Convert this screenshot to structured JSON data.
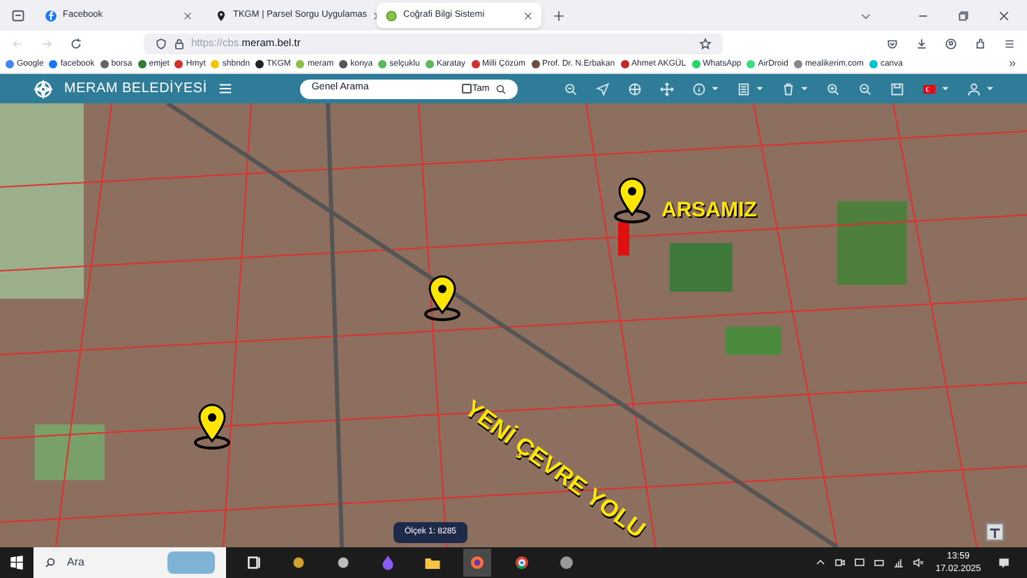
{
  "tabs": [
    {
      "label": "Facebook",
      "selected": false
    },
    {
      "label": "TKGM | Parsel Sorgu Uygulamas",
      "selected": false
    },
    {
      "label": "Coğrafi Bilgi Sistemi",
      "selected": true
    }
  ],
  "address_bar": {
    "url_prefix": "https://cbs.",
    "url_domain": "meram.bel.tr"
  },
  "bookmarks": [
    "Google",
    "facebook",
    "borsa",
    "emjet",
    "Hmyt",
    "shbndn",
    "TKGM",
    "meram",
    "konya",
    "selçuklu",
    "Karatay",
    "Milli Çözüm",
    "Prof. Dr. N.Erbakan",
    "Ahmet AKGÜL",
    "WhatsApp",
    "AirDroid",
    "mealikerim.com",
    "canva"
  ],
  "bookmarks_overflow": "»",
  "app_header": {
    "logo_text": "MERAM BELEDİYESİ",
    "search": {
      "value": "Genel Arama",
      "exact_label": "Tam",
      "exact_checked": false
    }
  },
  "map": {
    "annotations": [
      {
        "kind": "plot",
        "text": "ARSAMIZ"
      },
      {
        "kind": "road",
        "text": "YENİ ÇEVRE YOLU"
      }
    ],
    "scale": "Ölçek 1: 8285"
  },
  "taskbar": {
    "search_placeholder": "Ara",
    "time": "13:59",
    "date": "17.02.2025"
  }
}
